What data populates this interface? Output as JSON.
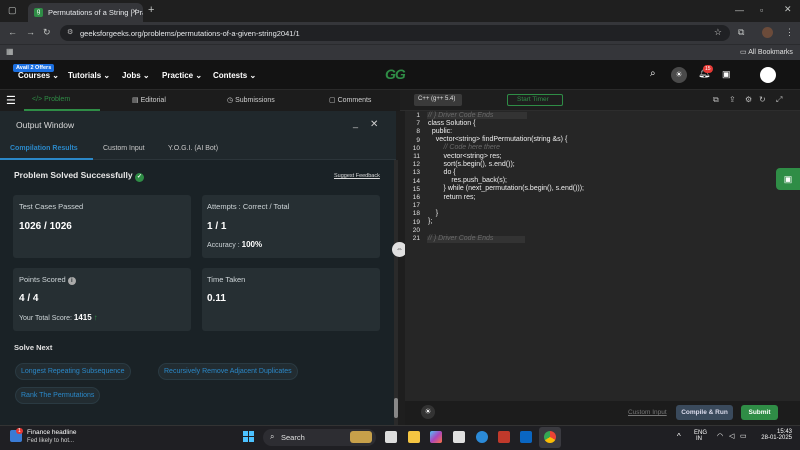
{
  "browser": {
    "tab_title": "Permutations of a String | Practice",
    "address": "geeksforgeeks.org/problems/permutations-of-a-given-string2041/1",
    "bookmarks_label": "All Bookmarks"
  },
  "site_nav": {
    "offers_badge": "Avail 2 Offers",
    "items": [
      "Courses",
      "Tutorials",
      "Jobs",
      "Practice",
      "Contests"
    ],
    "logo": "GG",
    "notification_count": "15"
  },
  "sub_tabs": [
    "Problem",
    "Editorial",
    "Submissions",
    "Comments"
  ],
  "output": {
    "title": "Output Window",
    "tabs": [
      "Compilation Results",
      "Custom Input",
      "Y.O.G.I. (AI Bot)"
    ],
    "status": "Problem Solved Successfully",
    "feedback": "Suggest Feedback",
    "test_cases_label": "Test Cases Passed",
    "test_cases_value": "1026 / 1026",
    "attempts_label": "Attempts : Correct / Total",
    "attempts_value": "1 / 1",
    "accuracy_label": "Accuracy :",
    "accuracy_value": "100%",
    "points_label": "Points Scored",
    "points_value": "4 / 4",
    "total_score_label": "Your Total Score:",
    "total_score_value": "1415",
    "time_label": "Time Taken",
    "time_value": "0.11",
    "solve_next_label": "Solve Next",
    "suggestions": [
      "Longest Repeating Subsequence",
      "Recursively Remove Adjacent Duplicates",
      "Rank The Permutations"
    ]
  },
  "editor": {
    "language": "C++ (g++ 5.4)",
    "start_timer": "Start Timer",
    "lines": [
      {
        "n": "1",
        "text": "// } Driver Code Ends"
      },
      {
        "n": "7",
        "text": "class Solution {"
      },
      {
        "n": "8",
        "text": "  public:"
      },
      {
        "n": "9",
        "text": "    vector<string> findPermutation(string &s) {"
      },
      {
        "n": "10",
        "text": "        // Code here there"
      },
      {
        "n": "11",
        "text": "        vector<string> res;"
      },
      {
        "n": "12",
        "text": "        sort(s.begin(), s.end());"
      },
      {
        "n": "13",
        "text": "        do {"
      },
      {
        "n": "14",
        "text": "            res.push_back(s);"
      },
      {
        "n": "15",
        "text": "        } while (next_permutation(s.begin(), s.end()));"
      },
      {
        "n": "16",
        "text": "        return res;"
      },
      {
        "n": "17",
        "text": ""
      },
      {
        "n": "18",
        "text": "    }"
      },
      {
        "n": "19",
        "text": "};"
      },
      {
        "n": "20",
        "text": ""
      },
      {
        "n": "21",
        "text": "// } Driver Code Ends"
      }
    ],
    "custom_input": "Custom Input",
    "compile_run": "Compile & Run",
    "submit": "Submit"
  },
  "taskbar": {
    "news_title": "Finance headline",
    "news_sub": "Fed likely to hot...",
    "news_badge": "1",
    "search_placeholder": "Search",
    "lang": "ENG",
    "region": "IN",
    "time": "15:43",
    "date": "28-01-2025"
  },
  "colors": {
    "gfg_green": "#2f8d46",
    "link_blue": "#2b88c8",
    "panel_bg": "#1a2226",
    "card_bg": "#262f33"
  }
}
